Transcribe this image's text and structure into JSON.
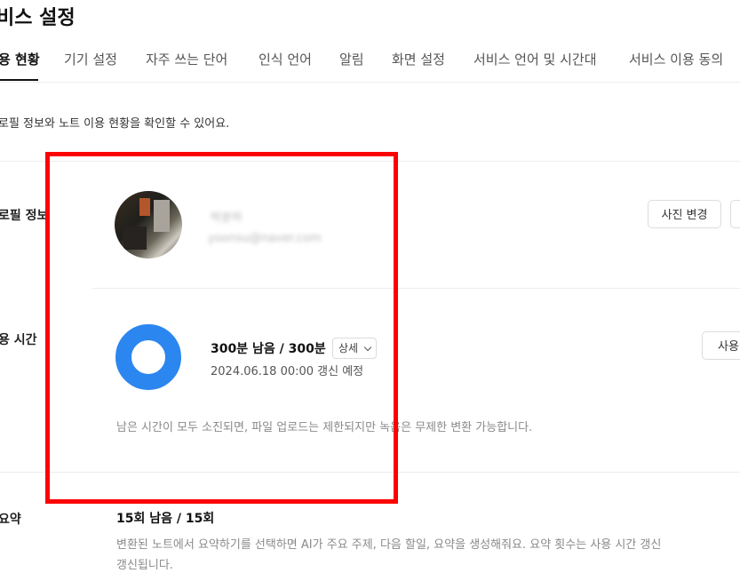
{
  "page": {
    "title": "비스 설정"
  },
  "tabs": [
    {
      "label": "용 현황"
    },
    {
      "label": "기기 설정"
    },
    {
      "label": "자주 쓰는 단어"
    },
    {
      "label": "인식 언어"
    },
    {
      "label": "알림"
    },
    {
      "label": "화면 설정"
    },
    {
      "label": "서비스 언어 및 시간대"
    },
    {
      "label": "서비스 이용 동의"
    }
  ],
  "description": "로필 정보와 노트 이용 현황을 확인할 수 있어요.",
  "profile": {
    "label": "로필 정보",
    "name": "박분하",
    "email": "yoonsu@naver.com",
    "change_photo_button": "사진 변경"
  },
  "usage": {
    "label": "용 시간",
    "title": "300분 남음 / 300분",
    "detail_button": "상세",
    "renewal": "2024.06.18 00:00 갱신 예정",
    "note": "남은 시간이 모두 소진되면, 파일 업로드는 제한되지만 녹음은 무제한 변환 가능합니다.",
    "side_button": "사용",
    "remaining_fraction": 1.0,
    "ring_color": "#2b86f0"
  },
  "summary": {
    "label": "요약",
    "title": "15회 남음 / 15회",
    "desc_line1": "변환된 노트에서 요약하기를 선택하면 AI가 주요 주제, 다음 할일, 요약을 생성해줘요. 요약 횟수는 사용 시간 갱신",
    "desc_line2": "갱신됩니다."
  },
  "colors": {
    "highlight": "#ff0000",
    "accent": "#2b86f0"
  }
}
